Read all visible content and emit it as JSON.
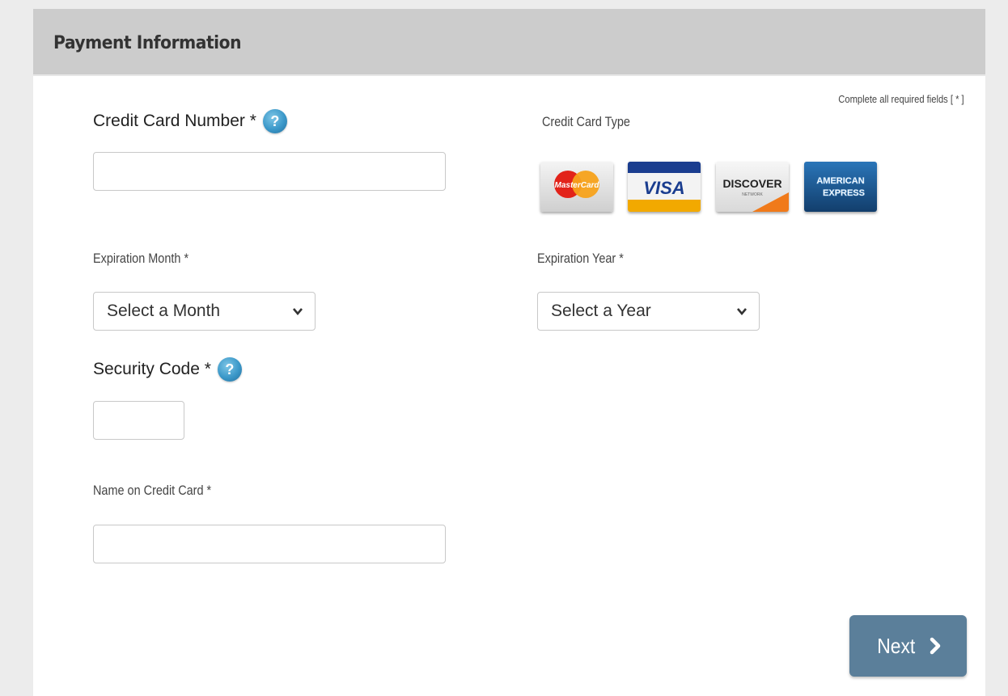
{
  "panel": {
    "title": "Payment Information",
    "required_note": "Complete all required fields [ * ]"
  },
  "card_number": {
    "label": "Credit Card Number *",
    "value": "",
    "help_icon": "question-mark-icon"
  },
  "card_type": {
    "label": "Credit Card Type",
    "cards": [
      {
        "name": "MasterCard",
        "color": "#e0e0e0"
      },
      {
        "name": "VISA",
        "color": "#1a3d8f"
      },
      {
        "name": "DISCOVER",
        "color": "#f07a1a"
      },
      {
        "name": "AMERICAN EXPRESS",
        "color": "#1f5f9f"
      }
    ],
    "mastercard_text": "MasterCard",
    "visa_text": "VISA",
    "discover_text": "DISCOVER",
    "discover_sub": "NETWORK",
    "amex_line1": "AMERICAN",
    "amex_line2": "EXPRESS"
  },
  "exp_month": {
    "label": "Expiration Month *",
    "selected": "Select a Month"
  },
  "exp_year": {
    "label": "Expiration Year *",
    "selected": "Select a Year"
  },
  "security_code": {
    "label": "Security Code *",
    "value": "",
    "help_icon": "question-mark-icon"
  },
  "name_on_card": {
    "label": "Name on Credit Card *",
    "value": ""
  },
  "next_button": {
    "label": "Next",
    "icon": "chevron-right-icon",
    "color": "#5b7f9a"
  },
  "colors": {
    "header_bg": "#cccccc",
    "page_bg": "#ececec",
    "help_icon": "#3b98c9"
  }
}
